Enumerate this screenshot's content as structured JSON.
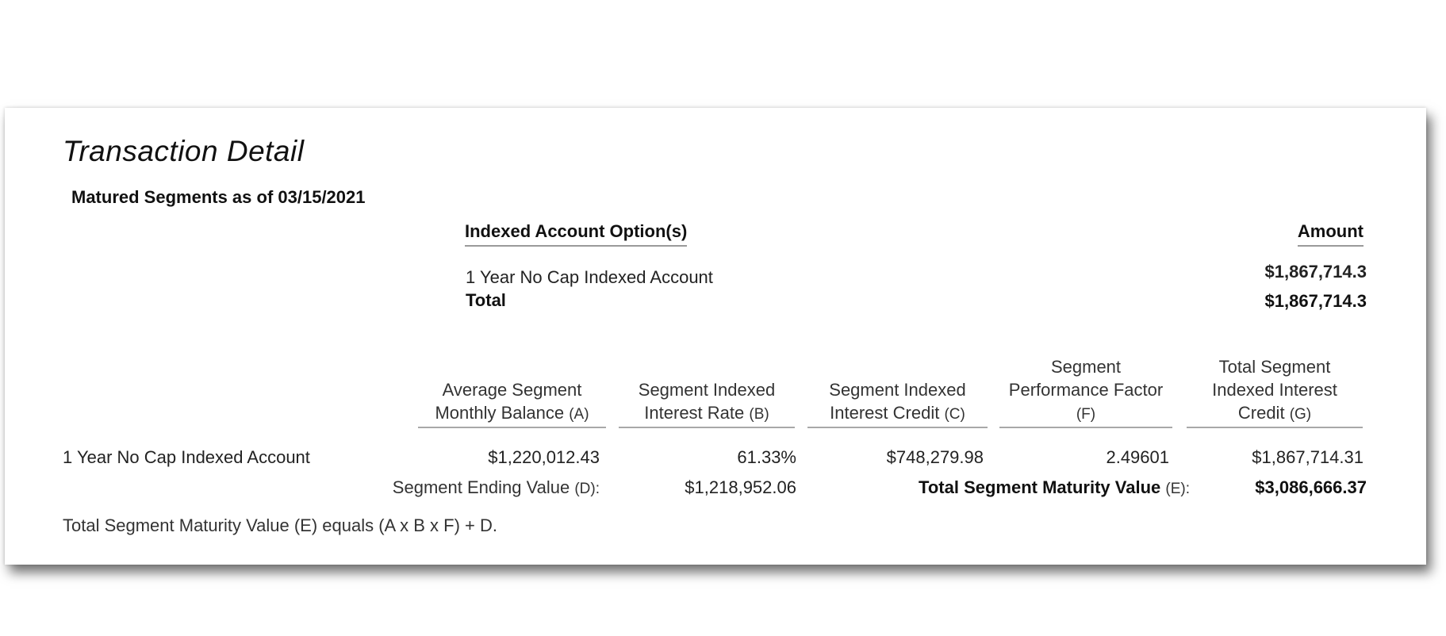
{
  "document": {
    "title": "Transaction Detail",
    "subtitle": "Matured Segments as of 03/15/2021"
  },
  "options_table": {
    "header_option": "Indexed Account Option(s)",
    "header_amount": "Amount",
    "rows": [
      {
        "option": "1 Year No Cap Indexed Account",
        "amount": "$1,867,714.3"
      }
    ],
    "total_label": "Total",
    "total_amount": "$1,867,714.3"
  },
  "segment_table": {
    "columns": [
      {
        "label": "Average Segment Monthly Balance",
        "code": "(A)"
      },
      {
        "label": "Segment Indexed Interest Rate",
        "code": "(B)"
      },
      {
        "label": "Segment Indexed Interest Credit",
        "code": "(C)"
      },
      {
        "label": "Segment Performance Factor",
        "code": "(F)"
      },
      {
        "label": "Total Segment Indexed Interest Credit",
        "code": "(G)"
      }
    ],
    "row": {
      "name": "1 Year No Cap Indexed Account",
      "values": [
        "$1,220,012.43",
        "61.33%",
        "$748,279.98",
        "2.49601",
        "$1,867,714.31"
      ]
    },
    "ending_value_label": "Segment Ending Value",
    "ending_value_code": "(D):",
    "ending_value": "$1,218,952.06",
    "maturity_label": "Total Segment Maturity Value",
    "maturity_code": "(E):",
    "maturity_value": "$3,086,666.37"
  },
  "footnote": "Total Segment Maturity Value (E) equals (A x B x F) + D."
}
